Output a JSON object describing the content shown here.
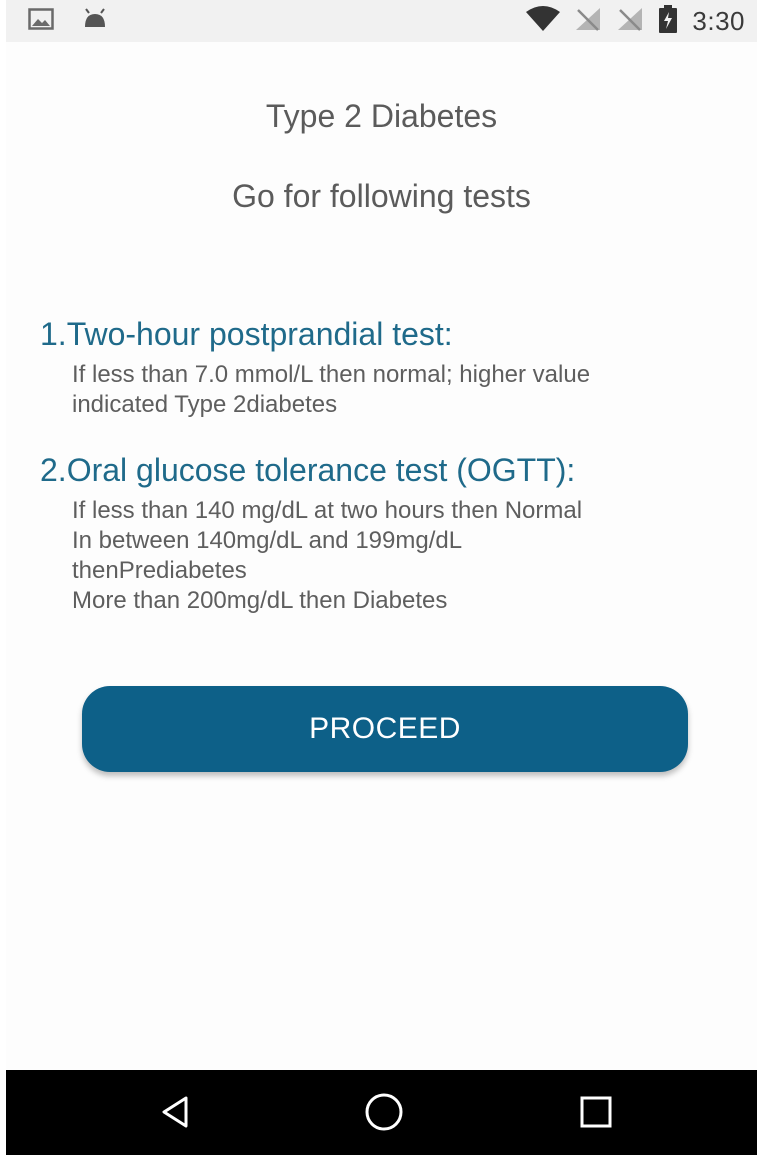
{
  "status_bar": {
    "time": "3:30",
    "icons": [
      "image-icon",
      "android-icon",
      "wifi-icon",
      "no-signal-icon",
      "no-signal-icon",
      "battery-charging-icon"
    ]
  },
  "screen": {
    "title": "Type 2 Diabetes",
    "subtitle": "Go for following tests"
  },
  "tests": [
    {
      "heading": "1.Two-hour postprandial test:",
      "lines": [
        "If less than 7.0 mmol/L then normal; higher value",
        "indicated Type 2diabetes"
      ]
    },
    {
      "heading": "2.Oral glucose tolerance test (OGTT):",
      "lines": [
        "If less than 140 mg/dL at two hours then Normal",
        "In between 140mg/dL and 199mg/dL",
        "thenPrediabetes",
        "More than 200mg/dL then Diabetes"
      ]
    }
  ],
  "actions": {
    "proceed_label": "PROCEED"
  },
  "colors": {
    "accent": "#0d6088",
    "heading": "#1f6a8a",
    "text": "#5e5e5e"
  }
}
